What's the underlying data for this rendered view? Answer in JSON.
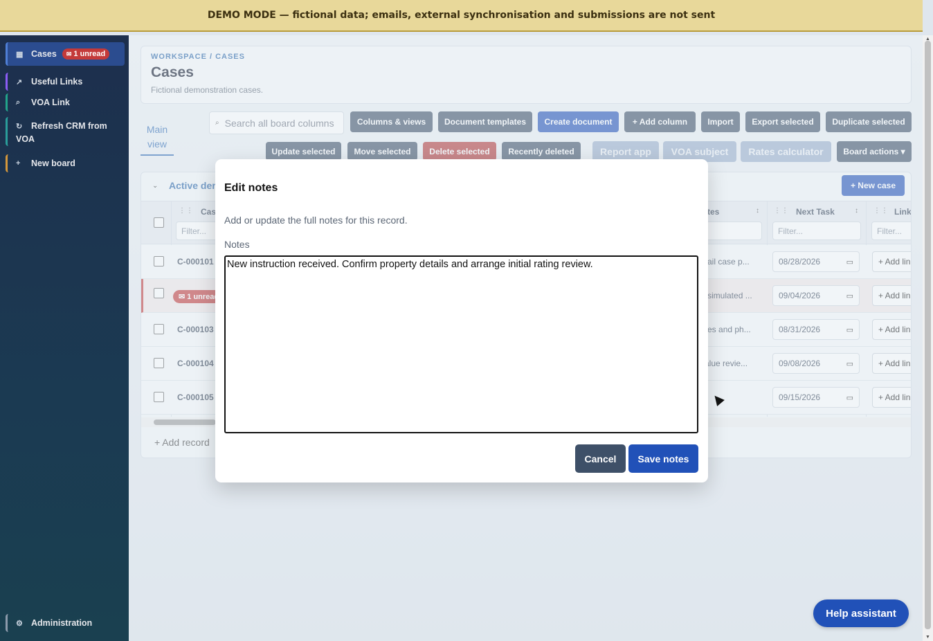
{
  "banner": {
    "text": "DEMO MODE — fictional data; emails, external synchronisation and submissions are not sent"
  },
  "sidebar": {
    "items": [
      {
        "label": "Cases",
        "icon": "▦",
        "badge": "1 unread",
        "badge_icon": "✉",
        "accent": "#4f7fd6"
      },
      {
        "label": "Useful Links",
        "icon": "↗",
        "accent": "#8b5cf6"
      },
      {
        "label": "VOA Link",
        "icon": "⌕",
        "accent": "#22a38a"
      },
      {
        "label": "Refresh CRM from VOA",
        "icon": "↻",
        "accent": "#2a9d9a"
      },
      {
        "label": "New board",
        "icon": "+",
        "accent": "#d4973b"
      },
      {
        "label": "Administration",
        "icon": "⚙",
        "accent": "#8c9aab"
      }
    ]
  },
  "header": {
    "breadcrumb": "WORKSPACE / CASES",
    "title": "Cases",
    "subtitle": "Fictional demonstration cases."
  },
  "toolbar": {
    "view_tab": "Main view",
    "search_placeholder": "Search all board columns",
    "buttons_row1": [
      "Columns & views",
      "Document templates",
      "Create document",
      "+ Add column",
      "Import",
      "Export selected",
      "Duplicate selected"
    ],
    "buttons_row2": [
      "Update selected",
      "Move selected",
      "Delete selected",
      "Recently deleted",
      "Report app",
      "VOA subject",
      "Rates calculator",
      "Board actions ▾"
    ]
  },
  "board": {
    "group_title": "Active der",
    "new_case_label": "+ New case",
    "columns": {
      "case": "Cas",
      "notes": "tes",
      "next_task": "Next Task",
      "links": "Link"
    },
    "filter_placeholder": "Filter...",
    "rows": [
      {
        "id": "C-000101",
        "notes": "etail case p...",
        "next_task": "08/28/2026",
        "link": "+ Add link"
      },
      {
        "id": "1 unread",
        "unread": true,
        "notes": "a simulated ...",
        "next_task": "09/04/2026",
        "link": "+ Add link"
      },
      {
        "id": "C-000103",
        "notes": "otes and ph...",
        "next_task": "08/31/2026",
        "link": "+ Add link"
      },
      {
        "id": "C-000104",
        "notes": "value revie...",
        "next_task": "09/08/2026",
        "link": "+ Add link"
      },
      {
        "id": "C-000105",
        "notes": "",
        "next_task": "09/15/2026",
        "link": "+ Add link"
      }
    ],
    "add_record": "+ Add record"
  },
  "modal": {
    "title": "Edit notes",
    "description": "Add or update the full notes for this record.",
    "field_label": "Notes",
    "field_value": "New instruction received. Confirm property details and arrange initial rating review.",
    "cancel_label": "Cancel",
    "save_label": "Save notes"
  },
  "help_button": "Help assistant"
}
